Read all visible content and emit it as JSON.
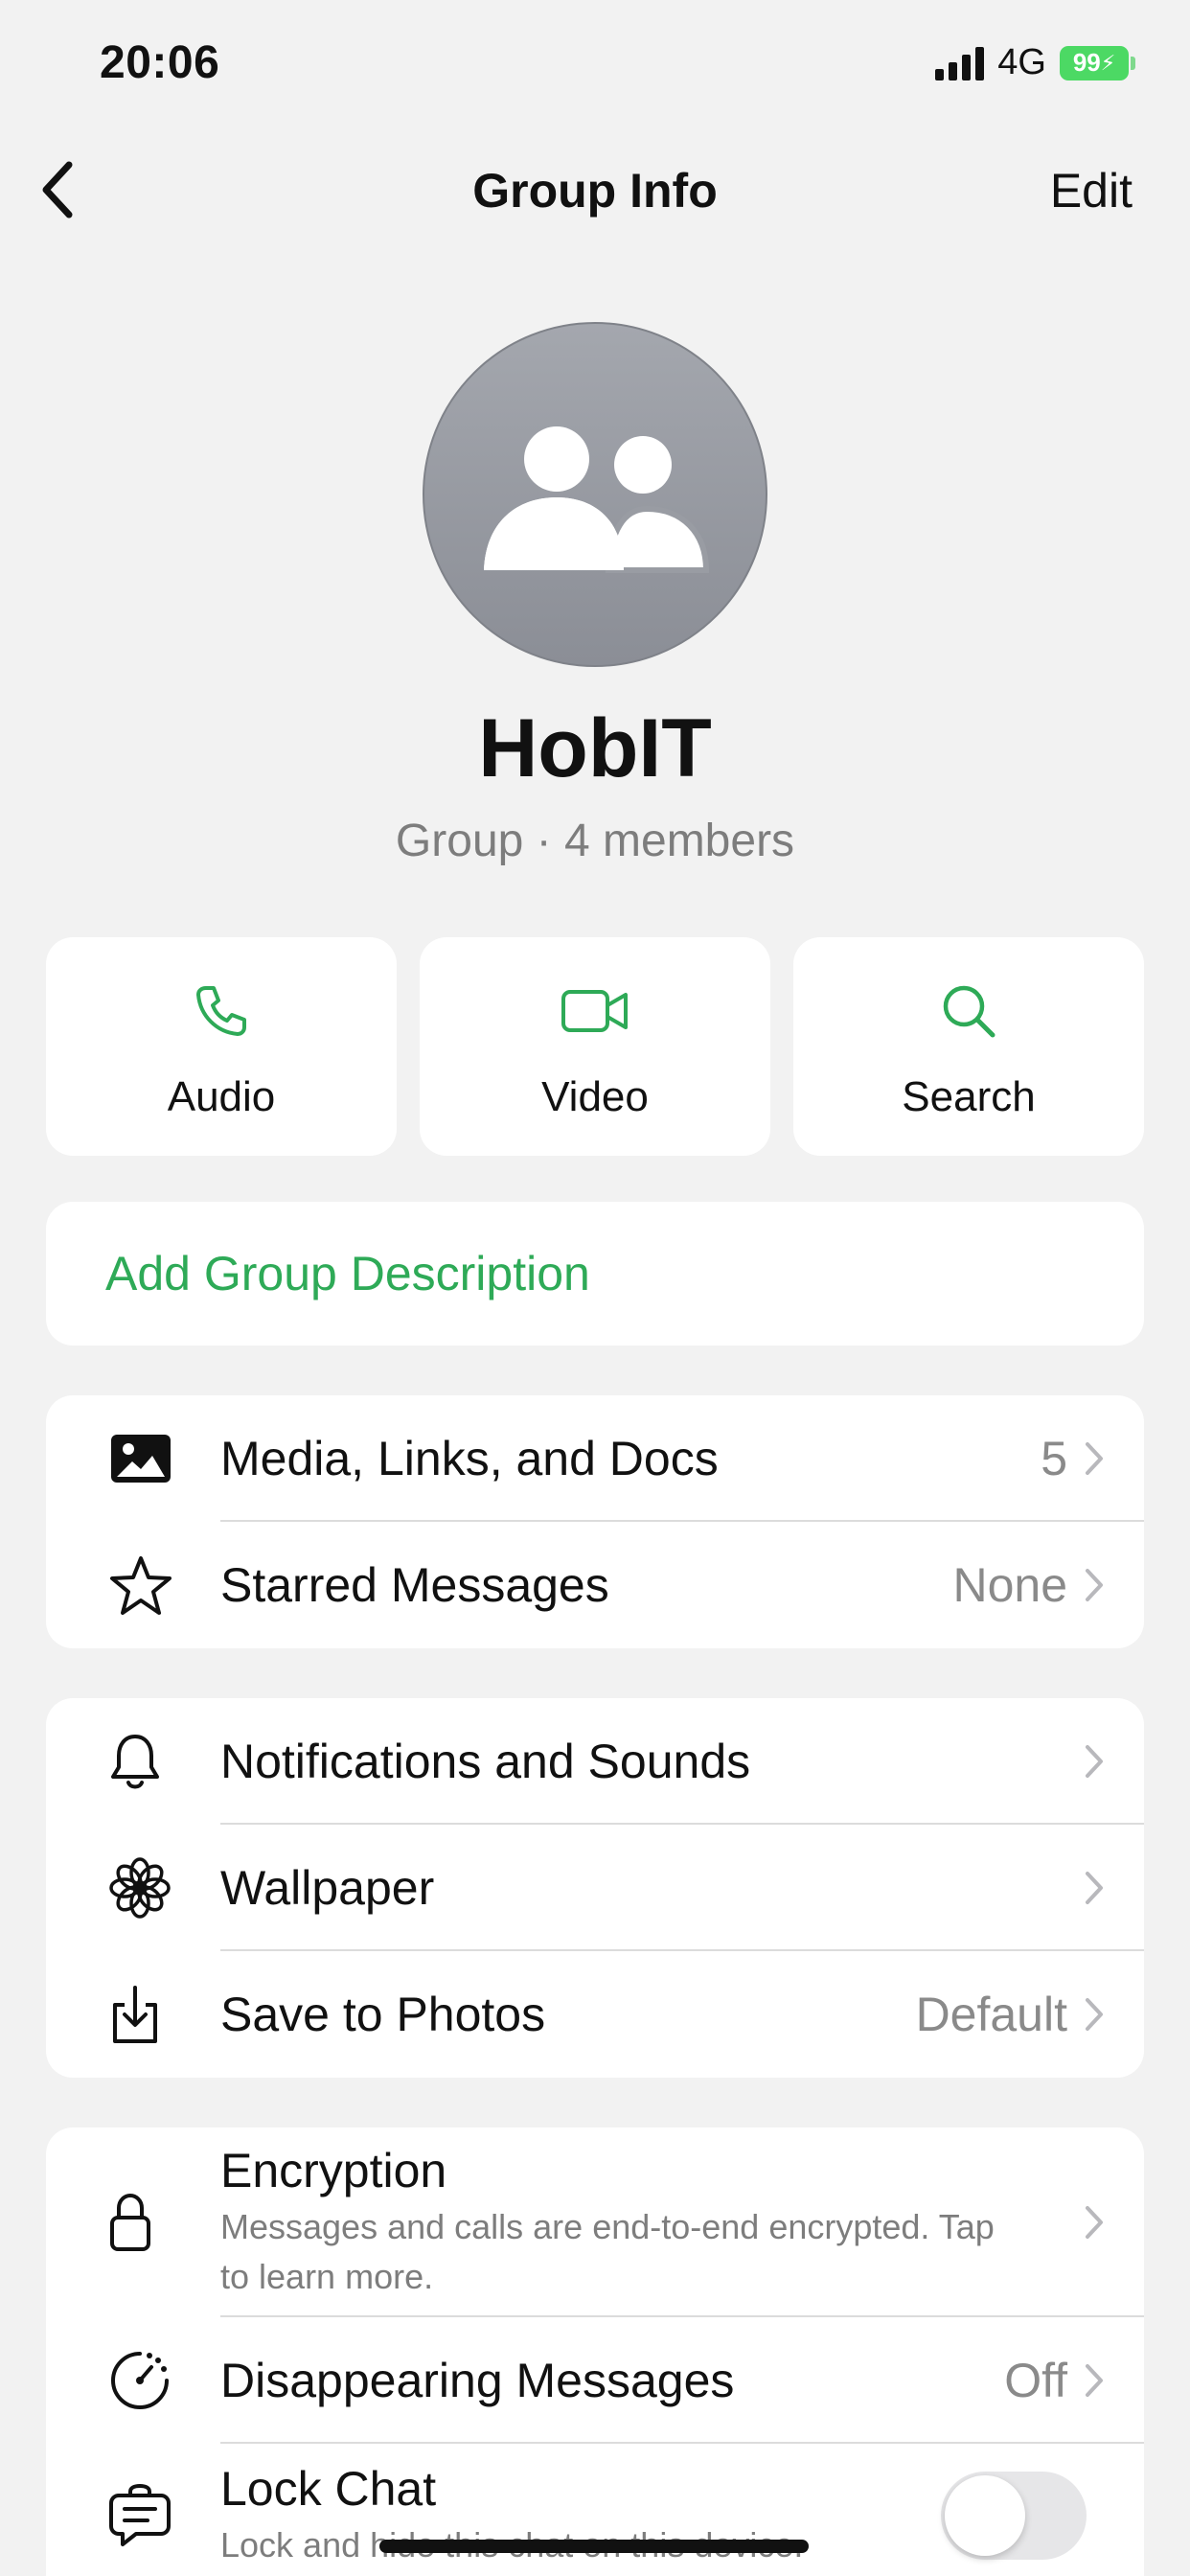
{
  "status_bar": {
    "time": "20:06",
    "network": "4G",
    "battery": "99"
  },
  "nav": {
    "back_icon": "chevron-left-icon",
    "title": "Group Info",
    "edit_label": "Edit"
  },
  "profile": {
    "name": "HobIT",
    "subtitle": "Group · 4 members",
    "avatar_icon": "group-avatar-icon"
  },
  "actions": [
    {
      "label": "Audio",
      "icon": "phone-icon"
    },
    {
      "label": "Video",
      "icon": "video-camera-icon"
    },
    {
      "label": "Search",
      "icon": "magnifier-icon"
    }
  ],
  "description": {
    "label": "Add Group Description"
  },
  "media_section": [
    {
      "label": "Media, Links, and Docs",
      "value": "5",
      "icon": "image-icon"
    },
    {
      "label": "Starred Messages",
      "value": "None",
      "icon": "star-icon"
    }
  ],
  "settings_section": [
    {
      "label": "Notifications and Sounds",
      "value": "",
      "icon": "bell-icon"
    },
    {
      "label": "Wallpaper",
      "value": "",
      "icon": "flower-icon"
    },
    {
      "label": "Save to Photos",
      "value": "Default",
      "icon": "download-icon"
    }
  ],
  "privacy_section": {
    "encryption": {
      "label": "Encryption",
      "subtitle": "Messages and calls are end-to-end encrypted. Tap to learn more.",
      "icon": "lock-icon"
    },
    "disappearing": {
      "label": "Disappearing Messages",
      "value": "Off",
      "icon": "timer-icon"
    },
    "lock_chat": {
      "label": "Lock Chat",
      "subtitle": "Lock and hide this chat on this device.",
      "icon": "chat-lock-icon",
      "enabled": false
    }
  },
  "colors": {
    "accent": "#2eaa57",
    "background": "#f2f2f2",
    "battery": "#4cd964"
  }
}
